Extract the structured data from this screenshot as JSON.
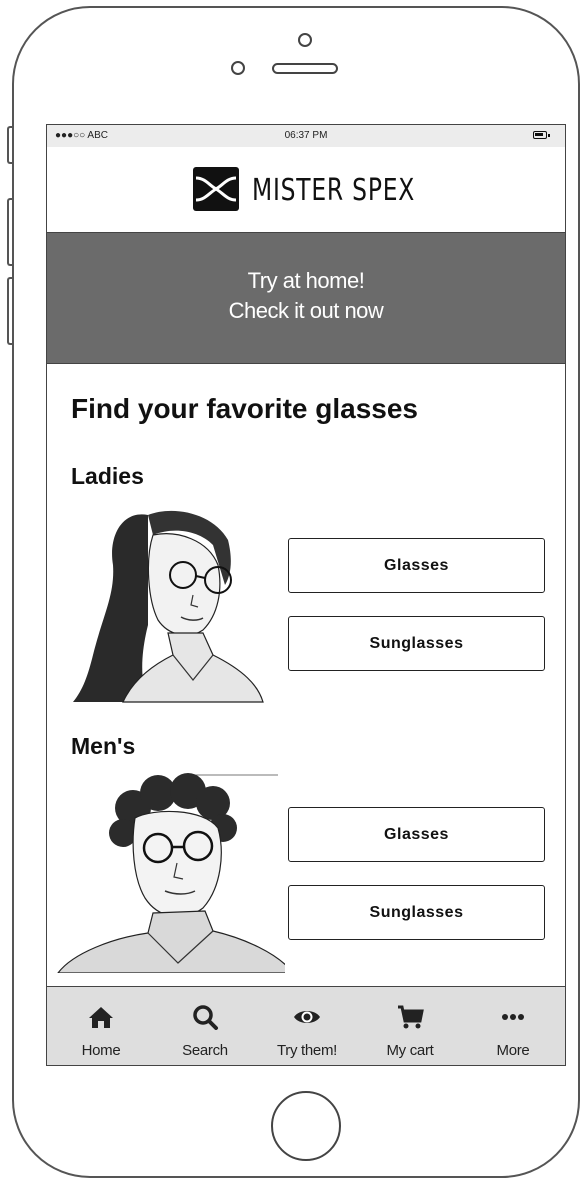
{
  "status_bar": {
    "carrier": "●●●○○ ABC",
    "time": "06:37 PM"
  },
  "header": {
    "brand": "MISTER SPEX",
    "logo_icon": "mister-spex-logo"
  },
  "banner": {
    "line1": "Try at home!",
    "line2": "Check it out now"
  },
  "main": {
    "title": "Find your favorite glasses",
    "sections": [
      {
        "title": "Ladies",
        "buttons": [
          "Glasses",
          "Sunglasses"
        ],
        "photo": "woman-with-glasses-sketch"
      },
      {
        "title": "Men's",
        "buttons": [
          "Glasses",
          "Sunglasses"
        ],
        "photo": "man-with-glasses-sketch"
      }
    ]
  },
  "tabbar": {
    "items": [
      {
        "label": "Home",
        "icon": "home-icon"
      },
      {
        "label": "Search",
        "icon": "search-icon"
      },
      {
        "label": "Try them!",
        "icon": "eye-icon"
      },
      {
        "label": "My cart",
        "icon": "cart-icon"
      },
      {
        "label": "More",
        "icon": "more-icon"
      }
    ]
  },
  "colors": {
    "banner_bg": "#6b6b6b",
    "tabbar_bg": "#dedede",
    "frame": "#555555"
  }
}
